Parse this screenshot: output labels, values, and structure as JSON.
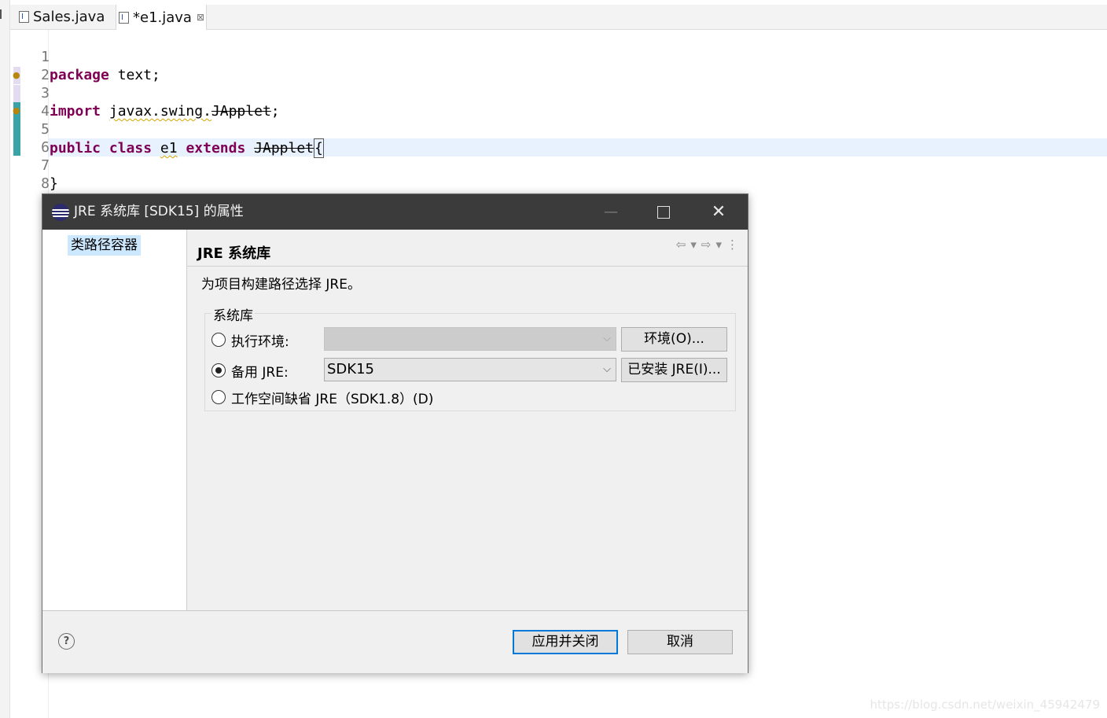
{
  "editor": {
    "tabs": [
      {
        "label": "Sales.java",
        "active": false
      },
      {
        "label": "*e1.java",
        "active": true,
        "close": "⊠"
      }
    ],
    "lines": [
      {
        "num": "1"
      },
      {
        "num": "2"
      },
      {
        "num": "3"
      },
      {
        "num": "4"
      },
      {
        "num": "5"
      },
      {
        "num": "6"
      },
      {
        "num": "7"
      },
      {
        "num": "8"
      }
    ],
    "tokens": {
      "package_kw": "package",
      "package_name": " text;",
      "import_kw": "import",
      "import_prefix": "javax.swing.",
      "import_class": "JApplet",
      "import_semicolon": ";",
      "public_kw": "public",
      "class_kw": "class",
      "class_name": "e1",
      "extends_kw": "extends",
      "super_class": "JApplet",
      "open_brace": "{",
      "close_brace": "}"
    }
  },
  "dialog": {
    "title": "JRE 系统库 [SDK15] 的属性",
    "left_item": "类路径容器",
    "header_title": "JRE 系统库",
    "description": "为项目构建路径选择 JRE。",
    "group_label": "系统库",
    "options": {
      "exec_env_label": "执行环境:",
      "exec_env_value": "",
      "exec_env_button": "环境(O)...",
      "alt_jre_label": "备用 JRE:",
      "alt_jre_value": "SDK15",
      "alt_jre_button": "已安装 JRE(I)...",
      "workspace_label": "工作空间缺省 JRE（SDK1.8）(D)",
      "selected": "alt_jre"
    },
    "help": "?",
    "apply_close_button": "应用并关闭",
    "cancel_button": "取消"
  },
  "watermark": "https://blog.csdn.net/weixin_45942479",
  "colors": {
    "keyword": "#7f0055",
    "current_line": "#e8f2fe",
    "titlebar": "#3b3b3b",
    "selection": "#cce8ff",
    "primary_border": "#0078d7"
  }
}
